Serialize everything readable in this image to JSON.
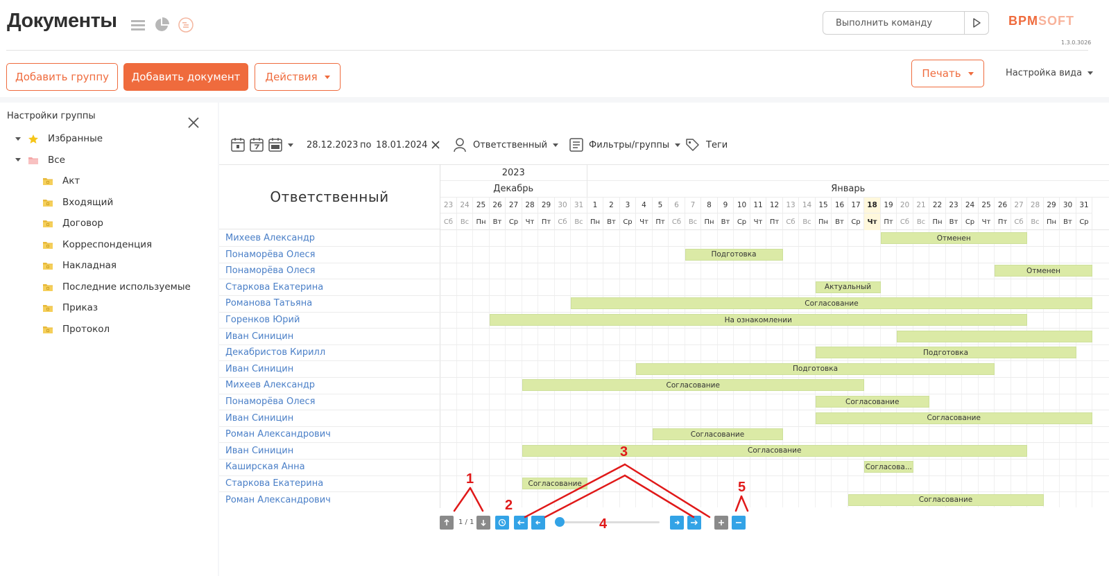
{
  "header": {
    "title": "Документы",
    "command_placeholder": "Выполнить команду",
    "logo_part1": "BPM",
    "logo_part2": "SOFT",
    "version": "1.3.0.3026"
  },
  "toolbar": {
    "add_group": "Добавить группу",
    "add_document": "Добавить документ",
    "actions": "Действия",
    "print": "Печать",
    "view_setup": "Настройка вида"
  },
  "sidebar": {
    "title": "Настройки группы",
    "tree": [
      {
        "label": "Избранные",
        "level": 0,
        "icon": "star-icon"
      },
      {
        "label": "Все",
        "level": 0,
        "icon": "folder-icon"
      },
      {
        "label": "Акт",
        "level": 1,
        "icon": "folder-icon"
      },
      {
        "label": "Входящий",
        "level": 1,
        "icon": "folder-icon"
      },
      {
        "label": "Договор",
        "level": 1,
        "icon": "folder-icon"
      },
      {
        "label": "Корреспонденция",
        "level": 1,
        "icon": "folder-icon"
      },
      {
        "label": "Накладная",
        "level": 1,
        "icon": "folder-icon"
      },
      {
        "label": "Последние используемые",
        "level": 1,
        "icon": "folder-icon"
      },
      {
        "label": "Приказ",
        "level": 1,
        "icon": "folder-icon"
      },
      {
        "label": "Протокол",
        "level": 1,
        "icon": "folder-icon"
      }
    ]
  },
  "filters": {
    "date_from": "28.12.2023",
    "date_sep": "по",
    "date_to": "18.01.2024",
    "responsible": "Ответственный",
    "filters_groups": "Фильтры/группы",
    "tags": "Теги"
  },
  "gantt": {
    "left_header": "Ответственный",
    "year": "2023",
    "months": [
      "Декабрь",
      "Январь"
    ],
    "days": [
      {
        "n": "23",
        "d": "Сб",
        "we": true
      },
      {
        "n": "24",
        "d": "Вс",
        "we": true
      },
      {
        "n": "25",
        "d": "Пн"
      },
      {
        "n": "26",
        "d": "Вт"
      },
      {
        "n": "27",
        "d": "Ср"
      },
      {
        "n": "28",
        "d": "Чт"
      },
      {
        "n": "29",
        "d": "Пт"
      },
      {
        "n": "30",
        "d": "Сб",
        "we": true
      },
      {
        "n": "31",
        "d": "Вс",
        "we": true
      },
      {
        "n": "1",
        "d": "Пн"
      },
      {
        "n": "2",
        "d": "Вт"
      },
      {
        "n": "3",
        "d": "Ср"
      },
      {
        "n": "4",
        "d": "Чт"
      },
      {
        "n": "5",
        "d": "Пт"
      },
      {
        "n": "6",
        "d": "Сб",
        "we": true
      },
      {
        "n": "7",
        "d": "Вс",
        "we": true
      },
      {
        "n": "8",
        "d": "Пн"
      },
      {
        "n": "9",
        "d": "Вт"
      },
      {
        "n": "10",
        "d": "Ср"
      },
      {
        "n": "11",
        "d": "Чт"
      },
      {
        "n": "12",
        "d": "Пт"
      },
      {
        "n": "13",
        "d": "Сб",
        "we": true
      },
      {
        "n": "14",
        "d": "Вс",
        "we": true
      },
      {
        "n": "15",
        "d": "Пн"
      },
      {
        "n": "16",
        "d": "Вт"
      },
      {
        "n": "17",
        "d": "Ср"
      },
      {
        "n": "18",
        "d": "Чт",
        "today": true
      },
      {
        "n": "19",
        "d": "Пт"
      },
      {
        "n": "20",
        "d": "Сб",
        "we": true
      },
      {
        "n": "21",
        "d": "Вс",
        "we": true
      },
      {
        "n": "22",
        "d": "Пн"
      },
      {
        "n": "23",
        "d": "Вт"
      },
      {
        "n": "24",
        "d": "Ср"
      },
      {
        "n": "25",
        "d": "Чт"
      },
      {
        "n": "26",
        "d": "Пт"
      },
      {
        "n": "27",
        "d": "Сб",
        "we": true
      },
      {
        "n": "28",
        "d": "Вс",
        "we": true
      },
      {
        "n": "29",
        "d": "Пн"
      },
      {
        "n": "30",
        "d": "Вт"
      },
      {
        "n": "31",
        "d": "Ср"
      }
    ],
    "rows": [
      {
        "name": "Михеев Александр",
        "bar": {
          "start": 27,
          "end": 36,
          "label": "Отменен"
        }
      },
      {
        "name": "Понаморёва Олеся",
        "bar": {
          "start": 15,
          "end": 21,
          "label": "Подготовка"
        }
      },
      {
        "name": "Понаморёва Олеся",
        "bar": {
          "start": 34,
          "end": 40,
          "label": "Отменен"
        }
      },
      {
        "name": "Старкова Екатерина",
        "bar": {
          "start": 23,
          "end": 27,
          "label": "Актуальный"
        }
      },
      {
        "name": "Романова Татьяна",
        "bar": {
          "start": 8,
          "end": 40,
          "label": "Согласование"
        }
      },
      {
        "name": "Горенков Юрий",
        "bar": {
          "start": 3,
          "end": 36,
          "label": "На ознакомлении"
        }
      },
      {
        "name": "Иван Синицин",
        "bar": {
          "start": 28,
          "end": 40,
          "label": ""
        }
      },
      {
        "name": "Декабристов Кирилл",
        "bar": {
          "start": 23,
          "end": 39,
          "label": "Подготовка"
        }
      },
      {
        "name": "Иван Синицин",
        "bar": {
          "start": 12,
          "end": 34,
          "label": "Подготовка"
        }
      },
      {
        "name": "Михеев Александр",
        "bar": {
          "start": 5,
          "end": 26,
          "label": "Согласование"
        }
      },
      {
        "name": "Понаморёва Олеся",
        "bar": {
          "start": 23,
          "end": 30,
          "label": "Согласование"
        }
      },
      {
        "name": "Иван Синицин",
        "bar": {
          "start": 23,
          "end": 40,
          "label": "Согласование"
        }
      },
      {
        "name": "Роман Александрович",
        "bar": {
          "start": 13,
          "end": 21,
          "label": "Согласование"
        }
      },
      {
        "name": "Иван Синицин",
        "bar": {
          "start": 5,
          "end": 36,
          "label": "Согласование"
        }
      },
      {
        "name": "Каширская Анна",
        "bar": {
          "start": 26,
          "end": 29,
          "label": "Согласова..."
        }
      },
      {
        "name": "Старкова Екатерина",
        "bar": {
          "start": 5,
          "end": 9,
          "label": "Согласование",
          "left": true
        }
      },
      {
        "name": "Роман Александрович",
        "bar": {
          "start": 25,
          "end": 37,
          "label": "Согласование"
        }
      }
    ]
  },
  "controls": {
    "page_info": "1 / 1"
  },
  "annotations": [
    "1",
    "2",
    "3",
    "4",
    "5"
  ],
  "colors": {
    "accent": "#ef6b3d",
    "link": "#4a7fc7",
    "bar": "#dbeaa6",
    "control_blue": "#33a3e6",
    "control_grey": "#8a8a8a",
    "annotation": "#e01919"
  }
}
